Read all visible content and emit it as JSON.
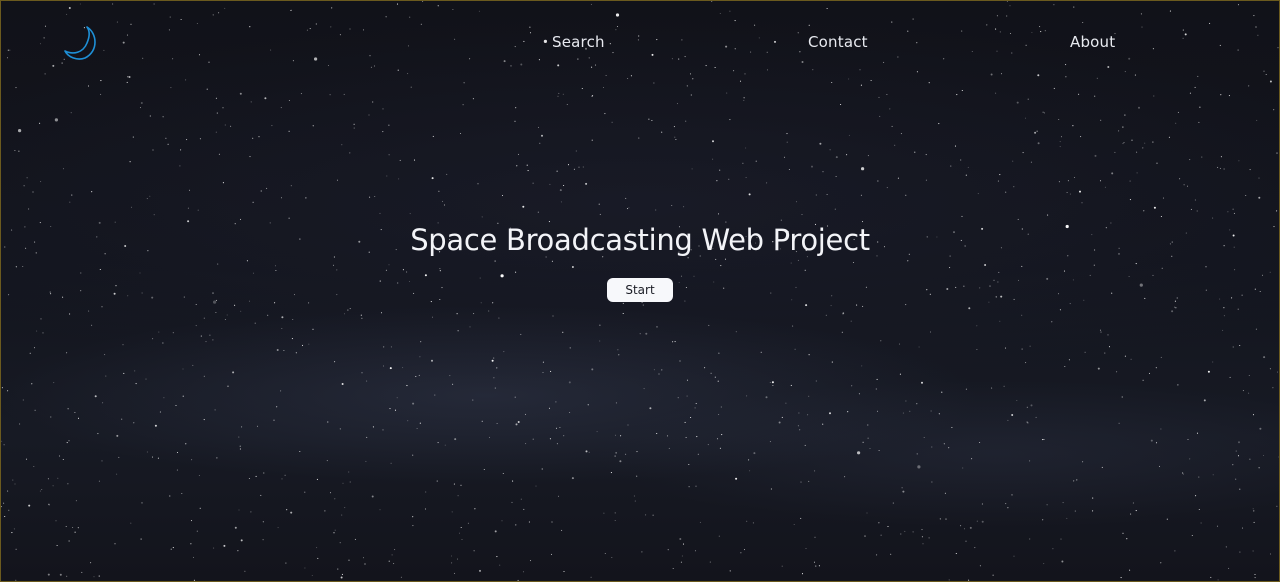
{
  "header": {
    "logo_icon": "crescent-moon-icon",
    "logo_color": "#1e8fd6",
    "nav": [
      {
        "label": "Search"
      },
      {
        "label": "Contact"
      },
      {
        "label": "About"
      }
    ]
  },
  "hero": {
    "title": "Space Broadcasting Web Project",
    "button_label": "Start"
  },
  "colors": {
    "background": "#111219",
    "text": "#f3f4f8",
    "button_bg": "#f7f8fb"
  }
}
